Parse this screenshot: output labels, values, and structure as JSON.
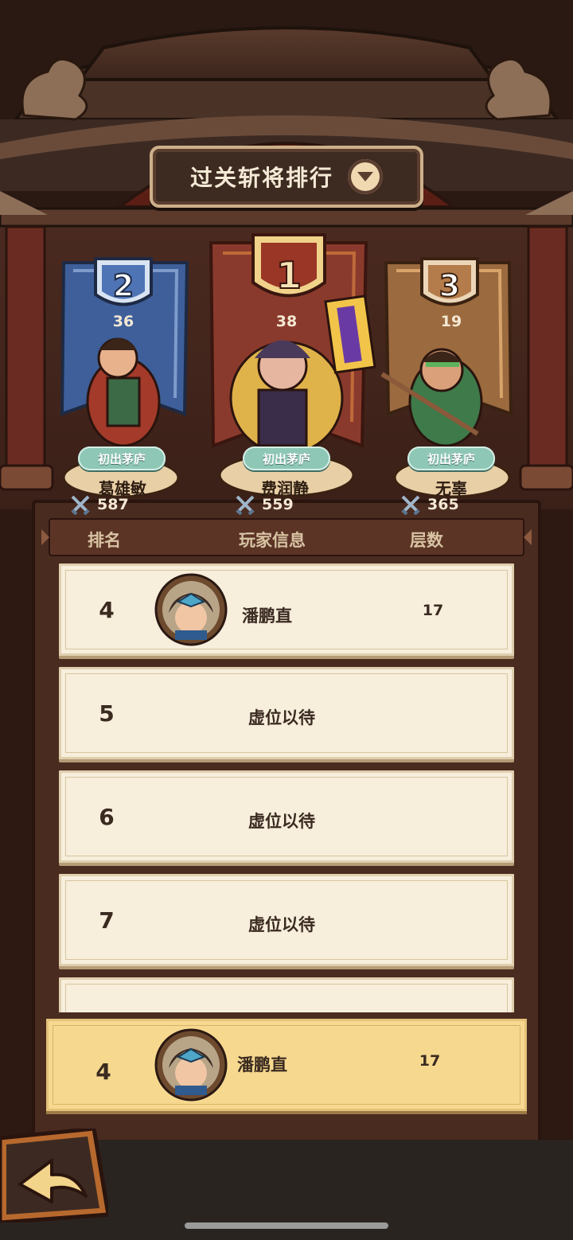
{
  "title": {
    "label": "过关斩将排行",
    "dropdown_icon": "chevron-down-icon"
  },
  "podium": [
    {
      "rank": "2",
      "score": "36",
      "badge": "初出茅庐",
      "name": "葛雄敏",
      "power": "587",
      "banner_color": "#3e5f9a"
    },
    {
      "rank": "1",
      "score": "38",
      "badge": "初出茅庐",
      "name": "费润静",
      "power": "559",
      "banner_color": "#8a3a2c"
    },
    {
      "rank": "3",
      "score": "19",
      "badge": "初出茅庐",
      "name": "无辜",
      "power": "365",
      "banner_color": "#9b6a3e"
    }
  ],
  "power_icon": "crossed-swords-icon",
  "columns": {
    "rank": "排名",
    "player": "玩家信息",
    "floors": "层数"
  },
  "rows": [
    {
      "rank": "4",
      "name": "潘鹏直",
      "floors": "17"
    },
    {
      "rank": "5",
      "placeholder": "虚位以待"
    },
    {
      "rank": "6",
      "placeholder": "虚位以待"
    },
    {
      "rank": "7",
      "placeholder": "虚位以待"
    }
  ],
  "self": {
    "rank": "4",
    "name": "潘鹏直",
    "floors": "17"
  },
  "back_icon": "back-arrow-icon"
}
